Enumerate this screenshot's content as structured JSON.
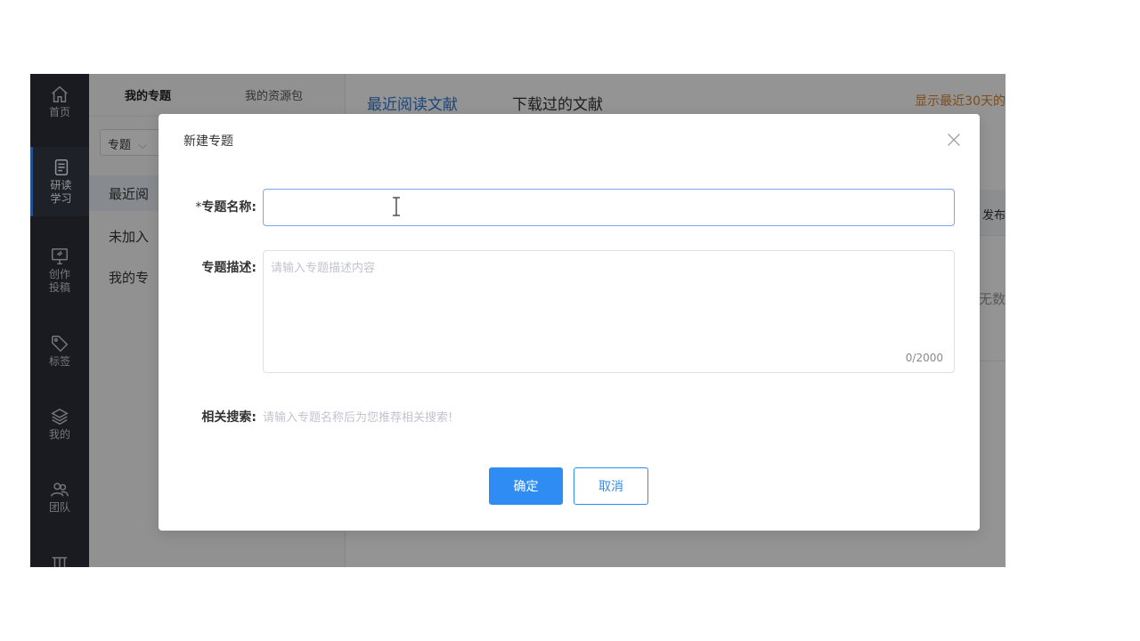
{
  "nav": {
    "items": [
      {
        "label": "首页",
        "icon": "home-icon"
      },
      {
        "label": "研读\n学习",
        "icon": "document-icon",
        "active": true
      },
      {
        "label": "创作\n投稿",
        "icon": "monitor-icon"
      },
      {
        "label": "标签",
        "icon": "tag-icon"
      },
      {
        "label": "我的",
        "icon": "layers-icon"
      },
      {
        "label": "团队",
        "icon": "team-icon"
      },
      {
        "label": "",
        "icon": "building-icon"
      }
    ]
  },
  "panel": {
    "tabs": [
      "我的专题",
      "我的资源包"
    ],
    "select_value": "专题",
    "items": [
      "最近阅",
      "未加入",
      "我的专"
    ]
  },
  "main": {
    "tabs": [
      "最近阅读文献",
      "下载过的文献"
    ],
    "note": "显示最近30天的",
    "col_header": "发布",
    "empty": "无数"
  },
  "modal": {
    "title": "新建专题",
    "name_label": "专题名称:",
    "name_required_mark": "*",
    "name_value": "",
    "desc_label": "专题描述:",
    "desc_placeholder": "请输入专题描述内容",
    "counter": "0/2000",
    "related_label": "相关搜索:",
    "related_hint": "请输入专题名称后为您推荐相关搜索!",
    "ok_label": "确定",
    "cancel_label": "取消"
  }
}
